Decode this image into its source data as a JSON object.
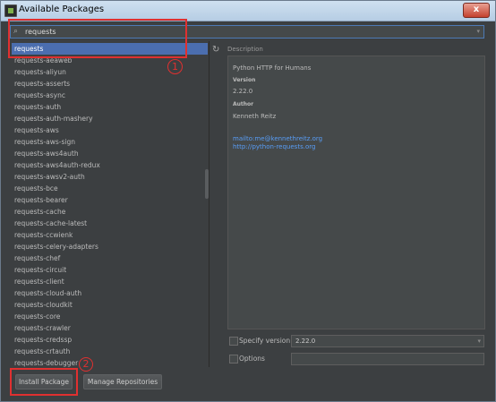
{
  "window": {
    "title": "Available Packages",
    "close_glyph": "x"
  },
  "search": {
    "value": "requests",
    "icon": "search-icon"
  },
  "annotations": {
    "one": "1",
    "two": "2",
    "color": "#e03030"
  },
  "packages": [
    "requests",
    "requests-aeaweb",
    "requests-aliyun",
    "requests-asserts",
    "requests-async",
    "requests-auth",
    "requests-auth-mashery",
    "requests-aws",
    "requests-aws-sign",
    "requests-aws4auth",
    "requests-aws4auth-redux",
    "requests-awsv2-auth",
    "requests-bce",
    "requests-bearer",
    "requests-cache",
    "requests-cache-latest",
    "requests-ccwienk",
    "requests-celery-adapters",
    "requests-chef",
    "requests-circuit",
    "requests-client",
    "requests-cloud-auth",
    "requests-cloudkit",
    "requests-core",
    "requests-crawler",
    "requests-credssp",
    "requests-crtauth",
    "requests-debugger"
  ],
  "description": {
    "label": "Description",
    "summary": "Python HTTP for Humans",
    "version_label": "Version",
    "version": "2.22.0",
    "author_label": "Author",
    "author": "Kenneth Reitz",
    "email_link": "mailto:me@kennethreitz.org",
    "url_link": "http://python-requests.org"
  },
  "options": {
    "specify_version_label": "Specify version",
    "specify_version_value": "2.22.0",
    "options_label": "Options",
    "options_value": ""
  },
  "buttons": {
    "install": "Install Package",
    "manage": "Manage Repositories"
  },
  "colors": {
    "background": "#3c3f41",
    "selection": "#4b6eaf",
    "link": "#589df6"
  }
}
